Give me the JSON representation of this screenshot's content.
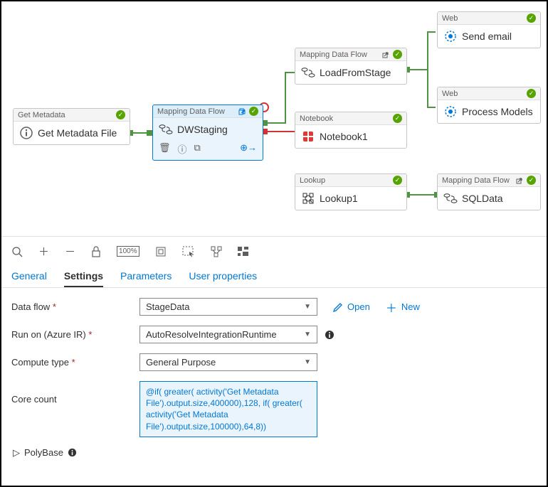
{
  "pipeline": {
    "getMetadata": {
      "type": "Get Metadata",
      "name": "Get Metadata File"
    },
    "dwStaging": {
      "type": "Mapping Data Flow",
      "name": "DWStaging"
    },
    "loadFromStage": {
      "type": "Mapping Data Flow",
      "name": "LoadFromStage"
    },
    "notebook": {
      "type": "Notebook",
      "name": "Notebook1"
    },
    "lookup": {
      "type": "Lookup",
      "name": "Lookup1"
    },
    "sendEmail": {
      "type": "Web",
      "name": "Send email"
    },
    "processModels": {
      "type": "Web",
      "name": "Process Models"
    },
    "sqlData": {
      "type": "Mapping Data Flow",
      "name": "SQLData"
    }
  },
  "tabs": {
    "general": "General",
    "settings": "Settings",
    "parameters": "Parameters",
    "userprops": "User properties"
  },
  "form": {
    "dataflow_label": "Data flow",
    "dataflow_value": "StageData",
    "runon_label": "Run on (Azure IR)",
    "runon_value": "AutoResolveIntegrationRuntime",
    "compute_label": "Compute type",
    "compute_value": "General Purpose",
    "corecount_label": "Core count",
    "corecount_expr": "@if( greater( activity('Get Metadata File').output.size,400000),128, if( greater( activity('Get Metadata File').output.size,100000),64,8))",
    "polybase_label": "PolyBase",
    "open_label": "Open",
    "new_label": "New"
  }
}
